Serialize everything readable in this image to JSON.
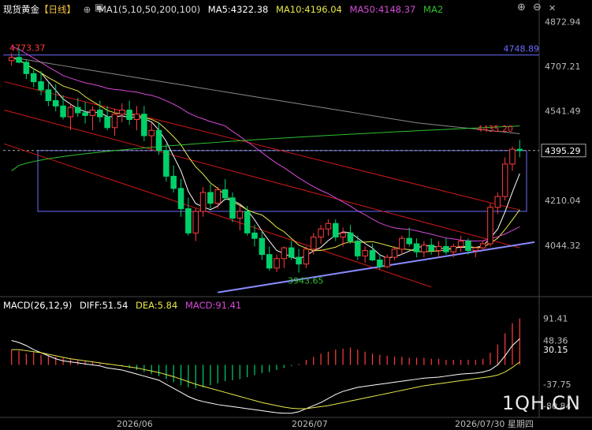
{
  "header": {
    "symbol": "现货黄金",
    "period": "【日线】",
    "ma_label": "MA1(5,10,50,200,100)",
    "ma5": "MA5:4322.38",
    "ma10": "MA10:4196.04",
    "ma50": "MA50:4148.37",
    "ma2": "MA2"
  },
  "macd_header": {
    "label": "MACD(26,12,9)",
    "diff": "DIFF:51.54",
    "dea": "DEA:5.84",
    "macd": "MACD:91.41"
  },
  "watermark": "1QH.CN",
  "colors": {
    "up": "#ff3d3d",
    "down": "#00d06a",
    "ma5": "#ffffff",
    "ma10": "#e8e84a",
    "ma50": "#d64ad6",
    "ma100": "#888888",
    "ma200": "#2fc02f",
    "diff": "#ffffff",
    "dea": "#e8e84a",
    "rect": "#6b6bff",
    "support": "#8a8aff",
    "channel": "#d01818"
  },
  "chart_data": [
    {
      "type": "candlestick",
      "title": "现货黄金【日线】",
      "y_ticks": [
        "4872.94",
        "4707.21",
        "4541.49",
        "4395.29",
        "4210.04",
        "4044.32"
      ],
      "ylim": [
        3860,
        4900
      ],
      "x_labels": [
        "2026/06",
        "2026/07",
        "2026/07/30 星期四"
      ],
      "annotations": {
        "high": "4773.37",
        "low": "3943.65",
        "recent_high": "4435.20",
        "rect_top": "4748.89",
        "current": "4395.29"
      },
      "candles": [
        [
          4728,
          4756,
          4710,
          4740
        ],
        [
          4740,
          4773,
          4718,
          4722
        ],
        [
          4722,
          4730,
          4660,
          4680
        ],
        [
          4680,
          4700,
          4630,
          4650
        ],
        [
          4650,
          4690,
          4600,
          4620
        ],
        [
          4620,
          4650,
          4560,
          4580
        ],
        [
          4580,
          4640,
          4540,
          4560
        ],
        [
          4560,
          4600,
          4510,
          4520
        ],
        [
          4520,
          4570,
          4470,
          4555
        ],
        [
          4555,
          4590,
          4520,
          4535
        ],
        [
          4535,
          4575,
          4495,
          4525
        ],
        [
          4525,
          4560,
          4470,
          4545
        ],
        [
          4545,
          4580,
          4500,
          4520
        ],
        [
          4520,
          4560,
          4470,
          4480
        ],
        [
          4480,
          4550,
          4450,
          4530
        ],
        [
          4530,
          4570,
          4500,
          4545
        ],
        [
          4545,
          4580,
          4490,
          4510
        ],
        [
          4510,
          4560,
          4470,
          4530
        ],
        [
          4530,
          4560,
          4430,
          4450
        ],
        [
          4450,
          4500,
          4400,
          4470
        ],
        [
          4470,
          4500,
          4380,
          4395
        ],
        [
          4395,
          4420,
          4280,
          4300
        ],
        [
          4300,
          4340,
          4240,
          4255
        ],
        [
          4255,
          4290,
          4150,
          4180
        ],
        [
          4180,
          4220,
          4080,
          4090
        ],
        [
          4090,
          4180,
          4060,
          4170
        ],
        [
          4170,
          4260,
          4150,
          4240
        ],
        [
          4240,
          4270,
          4180,
          4200
        ],
        [
          4200,
          4260,
          4180,
          4250
        ],
        [
          4250,
          4290,
          4210,
          4220
        ],
        [
          4220,
          4240,
          4130,
          4145
        ],
        [
          4145,
          4190,
          4100,
          4170
        ],
        [
          4170,
          4190,
          4080,
          4090
        ],
        [
          4090,
          4120,
          4040,
          4070
        ],
        [
          4070,
          4100,
          3990,
          4010
        ],
        [
          4010,
          4040,
          3950,
          3960
        ],
        [
          3960,
          4010,
          3945,
          3995
        ],
        [
          3995,
          4040,
          3960,
          4035
        ],
        [
          4035,
          4060,
          3990,
          4000
        ],
        [
          4000,
          4030,
          3943,
          3975
        ],
        [
          3975,
          4040,
          3960,
          4030
        ],
        [
          4030,
          4090,
          4010,
          4075
        ],
        [
          4075,
          4120,
          4050,
          4105
        ],
        [
          4105,
          4140,
          4080,
          4125
        ],
        [
          4125,
          4140,
          4060,
          4075
        ],
        [
          4075,
          4110,
          4040,
          4090
        ],
        [
          4090,
          4120,
          4050,
          4060
        ],
        [
          4060,
          4080,
          3990,
          4005
        ],
        [
          4005,
          4040,
          3980,
          4025
        ],
        [
          4025,
          4050,
          3985,
          3990
        ],
        [
          3990,
          4010,
          3955,
          3965
        ],
        [
          3965,
          4010,
          3960,
          4000
        ],
        [
          4000,
          4040,
          3990,
          4030
        ],
        [
          4030,
          4080,
          4010,
          4070
        ],
        [
          4070,
          4110,
          4040,
          4050
        ],
        [
          4050,
          4070,
          4000,
          4020
        ],
        [
          4020,
          4060,
          4000,
          4045
        ],
        [
          4045,
          4070,
          4010,
          4025
        ],
        [
          4025,
          4060,
          4000,
          4040
        ],
        [
          4040,
          4070,
          4010,
          4020
        ],
        [
          4020,
          4050,
          4000,
          4040
        ],
        [
          4040,
          4080,
          4020,
          4060
        ],
        [
          4060,
          4070,
          4010,
          4025
        ],
        [
          4025,
          4040,
          4000,
          4035
        ],
        [
          4035,
          4060,
          4025,
          4050
        ],
        [
          4050,
          4200,
          4040,
          4185
        ],
        [
          4185,
          4240,
          4160,
          4225
        ],
        [
          4225,
          4370,
          4210,
          4345
        ],
        [
          4345,
          4410,
          4320,
          4400
        ],
        [
          4400,
          4435,
          4370,
          4395
        ]
      ],
      "horizontal_lines": [
        4395.29
      ],
      "rectangle": {
        "top": 4395,
        "bottom": 4170
      },
      "reference_line": 4748.89
    },
    {
      "type": "bar",
      "title": "MACD(26,12,9)",
      "y_ticks": [
        "91.41",
        "48.36",
        "30.15",
        "-37.75",
        "-80.84"
      ],
      "ylim": [
        -100,
        100
      ],
      "macd_bars": [
        30,
        28,
        22,
        25,
        20,
        18,
        16,
        14,
        12,
        10,
        8,
        6,
        4,
        2,
        0,
        -3,
        -6,
        -10,
        -14,
        -18,
        -22,
        -28,
        -34,
        -40,
        -44,
        -46,
        -44,
        -40,
        -36,
        -32,
        -30,
        -28,
        -24,
        -20,
        -16,
        -14,
        -10,
        -6,
        -2,
        2,
        10,
        16,
        22,
        26,
        30,
        32,
        34,
        30,
        26,
        22,
        20,
        18,
        16,
        16,
        14,
        14,
        14,
        12,
        12,
        10,
        10,
        10,
        10,
        10,
        12,
        24,
        40,
        62,
        82,
        91.41
      ],
      "diff": [
        48,
        44,
        38,
        30,
        24,
        18,
        12,
        8,
        6,
        4,
        2,
        0,
        -2,
        -6,
        -8,
        -10,
        -14,
        -18,
        -22,
        -26,
        -30,
        -38,
        -46,
        -54,
        -62,
        -68,
        -72,
        -75,
        -78,
        -80,
        -82,
        -84,
        -86,
        -88,
        -90,
        -92,
        -94,
        -95,
        -95,
        -92,
        -86,
        -80,
        -74,
        -66,
        -58,
        -52,
        -48,
        -44,
        -42,
        -40,
        -38,
        -36,
        -34,
        -32,
        -30,
        -28,
        -26,
        -25,
        -24,
        -22,
        -20,
        -18,
        -17,
        -16,
        -14,
        -10,
        0,
        18,
        38,
        51.54
      ],
      "dea": [
        30,
        30,
        28,
        26,
        24,
        21,
        18,
        15,
        12,
        10,
        8,
        6,
        4,
        2,
        0,
        -2,
        -4,
        -6,
        -9,
        -12,
        -15,
        -19,
        -23,
        -28,
        -33,
        -38,
        -42,
        -46,
        -50,
        -54,
        -58,
        -62,
        -66,
        -70,
        -74,
        -77,
        -80,
        -83,
        -85,
        -86,
        -86,
        -84,
        -82,
        -80,
        -77,
        -74,
        -71,
        -68,
        -65,
        -62,
        -59,
        -56,
        -53,
        -50,
        -47,
        -44,
        -41,
        -39,
        -37,
        -35,
        -33,
        -31,
        -29,
        -27,
        -25,
        -23,
        -20,
        -14,
        -5,
        5.84
      ]
    }
  ]
}
